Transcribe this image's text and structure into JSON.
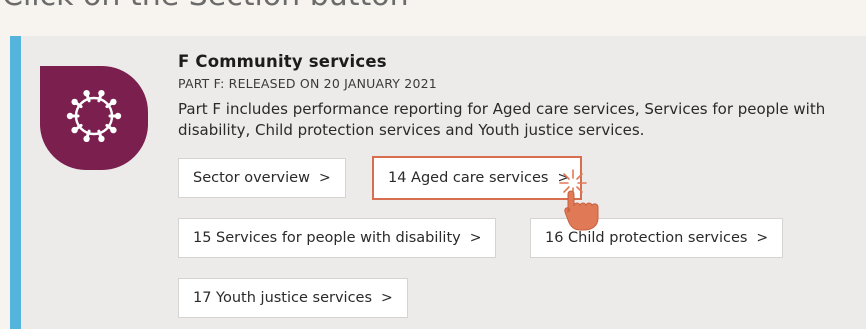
{
  "instruction": "Click on the Section button",
  "section": {
    "title": "F Community services",
    "subtitle": "PART F: RELEASED ON 20 JANUARY 2021",
    "description": "Part F includes performance reporting for Aged care services, Services for people with disability, Child protection services and Youth justice services."
  },
  "buttons": [
    {
      "label": "Sector overview",
      "chevron": ">"
    },
    {
      "label": "14 Aged care services",
      "chevron": ">",
      "highlighted": true
    },
    {
      "label": "15 Services for people with disability",
      "chevron": ">"
    },
    {
      "label": "16 Child protection services",
      "chevron": ">"
    },
    {
      "label": "17 Youth justice services",
      "chevron": ">"
    }
  ],
  "colors": {
    "background": "#f7f3ee",
    "card": "#ecebea",
    "accent_bar": "#55b4dc",
    "badge": "#7a1f4e",
    "highlight": "#d76e4f",
    "cursor": "#e07a56"
  },
  "icons": {
    "badge": "people-circle-icon",
    "cursor": "pointing-hand-icon",
    "click": "click-sparkle-icon"
  }
}
